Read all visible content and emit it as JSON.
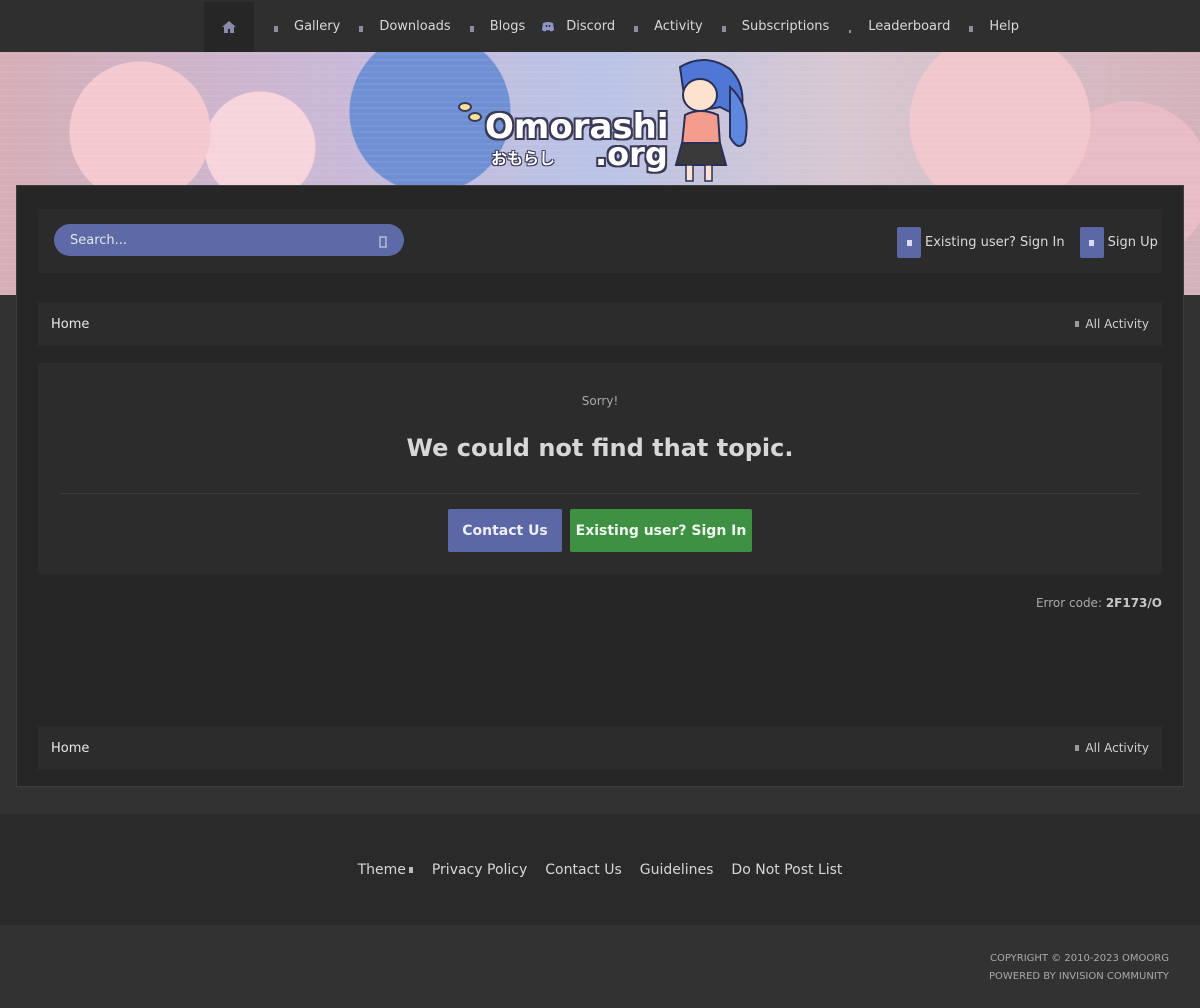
{
  "nav": {
    "home_icon": "home-icon",
    "items": [
      {
        "label": "Gallery",
        "icon": "bullet-icon"
      },
      {
        "label": "Downloads",
        "icon": "bullet-icon"
      },
      {
        "label": "Blogs",
        "icon": "bullet-icon"
      },
      {
        "label": "Discord",
        "icon": "discord-icon"
      },
      {
        "label": "Activity",
        "icon": "bullet-icon"
      },
      {
        "label": "Subscriptions",
        "icon": "bullet-icon"
      },
      {
        "label": "Leaderboard",
        "icon": "bullet-icon"
      },
      {
        "label": "Help",
        "icon": "bullet-icon"
      }
    ]
  },
  "banner": {
    "logo_word": "Omorashi",
    "logo_tld": ".org",
    "logo_kana": "おもらし"
  },
  "search": {
    "placeholder": "Search..."
  },
  "userlinks": {
    "signin": "Existing user? Sign In",
    "signup": "Sign Up"
  },
  "breadcrumb": {
    "home": "Home",
    "all_activity": "All Activity"
  },
  "error": {
    "sorry": "Sorry!",
    "message": "We could not find that topic.",
    "contact_button": "Contact Us",
    "signin_button": "Existing user? Sign In",
    "code_label": "Error code:",
    "code_value": "2F173/O"
  },
  "footer": {
    "links": {
      "theme": "Theme",
      "privacy": "Privacy Policy",
      "contact": "Contact Us",
      "guidelines": "Guidelines",
      "dnpl": "Do Not Post List"
    },
    "copyright": "COPYRIGHT © 2010-2023 OMOORG",
    "powered": "POWERED BY INVISION COMMUNITY"
  },
  "colors": {
    "accent": "#5c67a6",
    "success": "#3e9143",
    "background": "#323232"
  }
}
